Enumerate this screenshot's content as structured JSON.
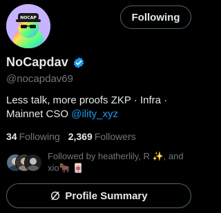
{
  "profile": {
    "display_name": "NoCapdav",
    "handle": "@nocapdav69",
    "verified": true,
    "avatar_cap_text": "NOCAP",
    "bio_text": "Less talk, more proofs ZKP · Infra · Mainnet CSO ",
    "bio_link": "@ility_xyz"
  },
  "actions": {
    "follow_label": "Following",
    "summary_label": "Profile Summary"
  },
  "stats": {
    "following_count": "34",
    "following_label": "Following",
    "followers_count": "2,369",
    "followers_label": "Followers"
  },
  "followed_by": {
    "text": "Followed by heatherlily, R ✨, and xio🐂 🀄"
  },
  "colors": {
    "background": "#000000",
    "text": "#e7e9ea",
    "muted": "#71767b",
    "accent": "#1d9bf0",
    "border": "#536471"
  }
}
